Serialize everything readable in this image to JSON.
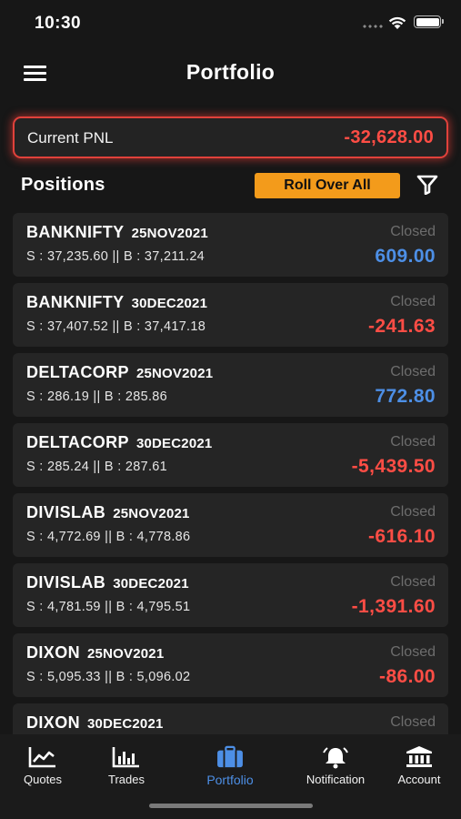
{
  "status_bar": {
    "time": "10:30"
  },
  "header": {
    "title": "Portfolio"
  },
  "pnl": {
    "label": "Current PNL",
    "value": "-32,628.00",
    "color": "#ff4d45"
  },
  "positions": {
    "title": "Positions",
    "roll_over_label": "Roll Over All",
    "items": [
      {
        "symbol": "BANKNIFTY",
        "expiry": "25NOV2021",
        "sell_buy": "S : 37,235.60 || B : 37,211.24",
        "status": "Closed",
        "pnl": "609.00",
        "sign": "positive"
      },
      {
        "symbol": "BANKNIFTY",
        "expiry": "30DEC2021",
        "sell_buy": "S : 37,407.52 || B : 37,417.18",
        "status": "Closed",
        "pnl": "-241.63",
        "sign": "negative"
      },
      {
        "symbol": "DELTACORP",
        "expiry": "25NOV2021",
        "sell_buy": "S : 286.19 || B : 285.86",
        "status": "Closed",
        "pnl": "772.80",
        "sign": "positive"
      },
      {
        "symbol": "DELTACORP",
        "expiry": "30DEC2021",
        "sell_buy": "S : 285.24 || B : 287.61",
        "status": "Closed",
        "pnl": "-5,439.50",
        "sign": "negative"
      },
      {
        "symbol": "DIVISLAB",
        "expiry": "25NOV2021",
        "sell_buy": "S : 4,772.69 || B : 4,778.86",
        "status": "Closed",
        "pnl": "-616.10",
        "sign": "negative"
      },
      {
        "symbol": "DIVISLAB",
        "expiry": "30DEC2021",
        "sell_buy": "S : 4,781.59 || B : 4,795.51",
        "status": "Closed",
        "pnl": "-1,391.60",
        "sign": "negative"
      },
      {
        "symbol": "DIXON",
        "expiry": "25NOV2021",
        "sell_buy": "S : 5,095.33 || B : 5,096.02",
        "status": "Closed",
        "pnl": "-86.00",
        "sign": "negative"
      },
      {
        "symbol": "DIXON",
        "expiry": "30DEC2021",
        "sell_buy": "",
        "status": "Closed",
        "pnl": "",
        "sign": "negative"
      }
    ]
  },
  "colors": {
    "positive": "#4d8fe6",
    "negative": "#ff4d45",
    "accent": "#f39b1b",
    "active_tab": "#4d8fe6"
  },
  "tabs": [
    {
      "label": "Quotes",
      "icon": "chart-line-icon",
      "active": false
    },
    {
      "label": "Trades",
      "icon": "bar-chart-icon",
      "active": false
    },
    {
      "label": "Portfolio",
      "icon": "briefcase-icon",
      "active": true
    },
    {
      "label": "Notification",
      "icon": "bell-icon",
      "active": false
    },
    {
      "label": "Account",
      "icon": "bank-icon",
      "active": false
    }
  ]
}
